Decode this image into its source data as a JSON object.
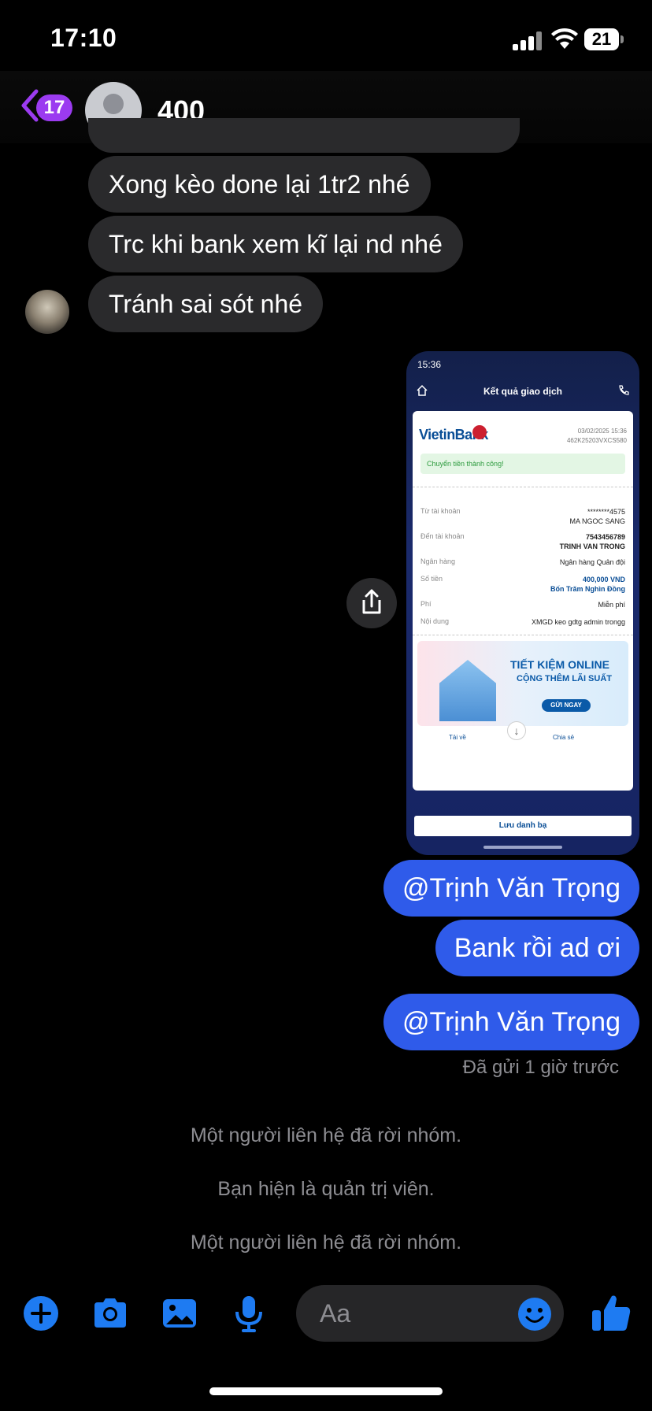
{
  "status_bar": {
    "time": "17:10",
    "battery": "21"
  },
  "header": {
    "back_badge": "17",
    "title": "400"
  },
  "messages_in": [
    "Xong kèo done lại 1tr2 nhé",
    "Trc khi bank xem kĩ lại nd nhé",
    "Tránh sai sót nhé"
  ],
  "receipt": {
    "status_time": "15:36",
    "title": "Kết quả giao dịch",
    "bank": "VietinBank",
    "date": "03/02/2025 15:36",
    "ref": "462K25203VXCS580",
    "success": "Chuyển tiền thành công!",
    "rows": [
      {
        "label": "Từ tài khoản",
        "value": "********4575",
        "value2": "MA NGOC SANG"
      },
      {
        "label": "Đến tài khoản",
        "value": "7543456789",
        "value2": "TRINH VAN TRONG"
      },
      {
        "label": "Ngân hàng",
        "value": "Ngân hàng Quân đội",
        "value2": ""
      },
      {
        "label": "Số tiền",
        "value": "400,000 VND",
        "value2": "Bốn Trăm Nghìn Đồng"
      },
      {
        "label": "Phí",
        "value": "Miễn phí",
        "value2": ""
      },
      {
        "label": "Nội dung",
        "value": "XMGD keo gdtg admin trongg",
        "value2": ""
      }
    ],
    "banner_title": "TIẾT KIỆM ONLINE",
    "banner_sub": "CỘNG THÊM LÃI SUẤT",
    "banner_button": "GỬI NGAY",
    "download": "Tải về",
    "share": "Chia sẻ",
    "save_contact": "Lưu danh bạ"
  },
  "messages_out": [
    "@Trịnh Văn Trọng",
    "Bank rồi ad ơi",
    "@Trịnh Văn Trọng"
  ],
  "sent_caption": "Đã gửi 1 giờ trước",
  "system_messages": [
    "Một người liên hệ đã rời nhóm.",
    "Bạn hiện là quản trị viên.",
    "Một người liên hệ đã rời nhóm."
  ],
  "composer": {
    "placeholder": "Aa"
  },
  "colors": {
    "accent": "#2f5bea",
    "badge": "#9b3bf0",
    "icon_blue": "#1e7bf2",
    "incoming": "#2a2a2c"
  }
}
